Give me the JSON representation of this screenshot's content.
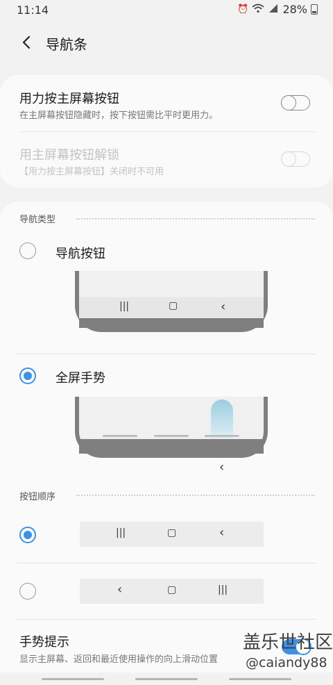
{
  "status_bar": {
    "time": "11:14",
    "battery": "28%",
    "icons": [
      "alarm-icon",
      "wifi-icon",
      "signal-4g-icon",
      "battery-icon"
    ]
  },
  "header": {
    "title": "导航条",
    "back_icon": "chevron-left-icon"
  },
  "settings": [
    {
      "title": "用力按主屏幕按钮",
      "subtitle": "在主屏幕按钮隐藏时，按下按钮需比平时更用力。",
      "enabled": true,
      "on": false
    },
    {
      "title": "用主屏幕按钮解锁",
      "subtitle": "【用力按主屏幕按钮】关闭时不可用",
      "enabled": false,
      "on": false
    }
  ],
  "navigation_type": {
    "label": "导航类型",
    "options": [
      {
        "label": "导航按钮",
        "selected": false,
        "glyphs": [
          "|||",
          "▢",
          "‹"
        ]
      },
      {
        "label": "全屏手势",
        "selected": true,
        "glyph": "‹"
      }
    ]
  },
  "button_order": {
    "label": "按钮顺序",
    "options": [
      {
        "selected": true,
        "glyphs": [
          "|||",
          "▢",
          "‹"
        ]
      },
      {
        "selected": false,
        "glyphs": [
          "‹",
          "▢",
          "|||"
        ]
      }
    ]
  },
  "gesture_hint": {
    "title": "手势提示",
    "subtitle": "显示主屏幕、返回和最近使用操作的向上滑动位置",
    "on": true
  },
  "watermark": {
    "line1": "盖乐世社区",
    "line2": "@caiandy88"
  },
  "colors": {
    "accent": "#3e91e4",
    "background": "#f2f2f2",
    "card": "#fafafa"
  }
}
